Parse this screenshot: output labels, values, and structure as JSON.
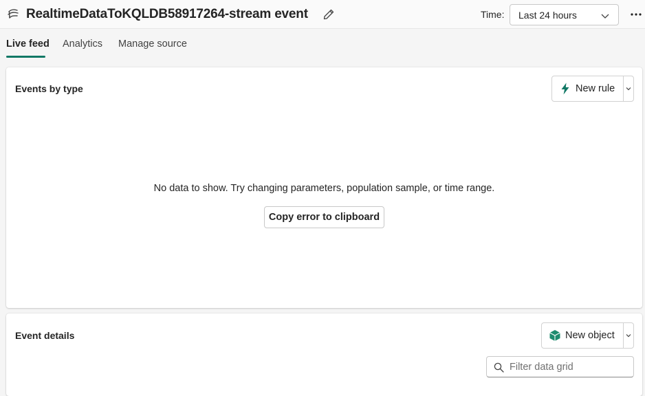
{
  "header": {
    "title": "RealtimeDataToKQLDB58917264-stream event",
    "time_label": "Time:",
    "time_value": "Last 24 hours"
  },
  "tabs": [
    {
      "label": "Live feed",
      "active": true
    },
    {
      "label": "Analytics",
      "active": false
    },
    {
      "label": "Manage source",
      "active": false
    }
  ],
  "events_by_type": {
    "title": "Events by type",
    "new_rule_label": "New rule",
    "empty_message": "No data to show. Try changing parameters, population sample, or time range.",
    "copy_error_label": "Copy error to clipboard"
  },
  "event_details": {
    "title": "Event details",
    "new_object_label": "New object",
    "filter_placeholder": "Filter data grid"
  },
  "colors": {
    "accent": "#117865",
    "rule_icon": "#117865",
    "object_icon": "#1f8c6f"
  },
  "icons": [
    "stream-icon",
    "edit-icon",
    "chevron-down-icon",
    "more-icon",
    "lightning-icon",
    "cube-icon",
    "search-icon"
  ]
}
